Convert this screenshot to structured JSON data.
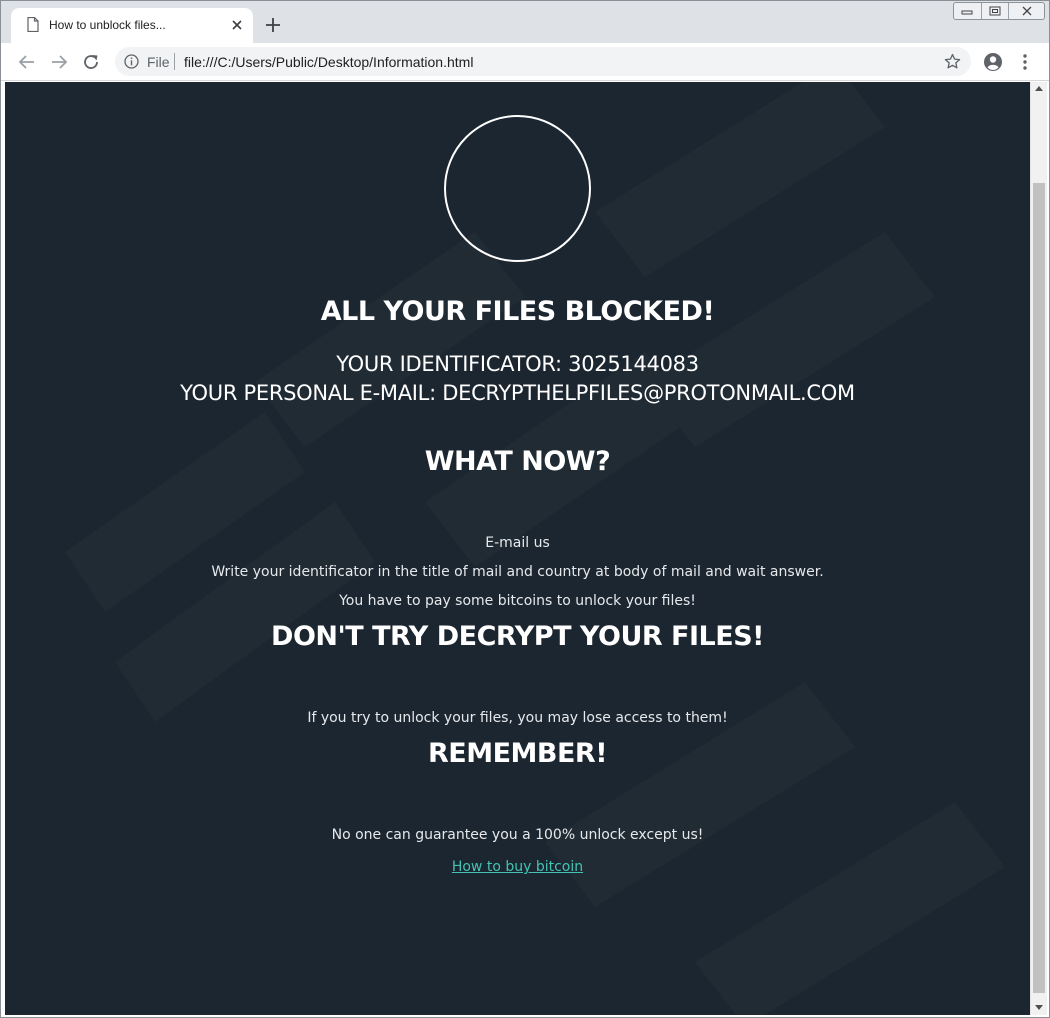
{
  "browser": {
    "tab": {
      "title": "How to unblock files..."
    },
    "address_bar": {
      "scheme_label": "File",
      "url": "file:///C:/Users/Public/Desktop/Information.html"
    }
  },
  "page": {
    "headline": "ALL YOUR FILES BLOCKED!",
    "identificator_line": "YOUR IDENTIFICATOR: 3025144083",
    "email_line": "YOUR PERSONAL E-MAIL: DECRYPTHELPFILES@PROTONMAIL.COM",
    "what_now_heading": "WHAT NOW?",
    "instructions": [
      "E-mail us",
      "Write your identificator in the title of mail and country at body of mail and wait answer.",
      "You have to pay some bitcoins to unlock your files!"
    ],
    "warning_heading": "DON'T TRY DECRYPT YOUR FILES!",
    "warning_text": "If you try to unlock your files, you may lose access to them!",
    "remember_heading": "REMEMBER!",
    "guarantee_text": "No one can guarantee you a 100% unlock except us!",
    "buy_link": "How to buy bitcoin"
  },
  "colors": {
    "page_background": "#1c2630",
    "text": "#ffffff",
    "link": "#44c3b2",
    "browser_tabstrip": "#dee1e6",
    "omnibox": "#f1f3f4"
  },
  "icons": {
    "tab": "page-icon",
    "tab_close": "close-icon",
    "new_tab": "plus-icon",
    "back": "arrow-left-icon",
    "forward": "arrow-right-icon",
    "reload": "reload-icon",
    "site_info": "info-icon",
    "bookmark": "star-icon",
    "profile": "account-circle-icon",
    "menu": "kebab-menu-icon"
  }
}
